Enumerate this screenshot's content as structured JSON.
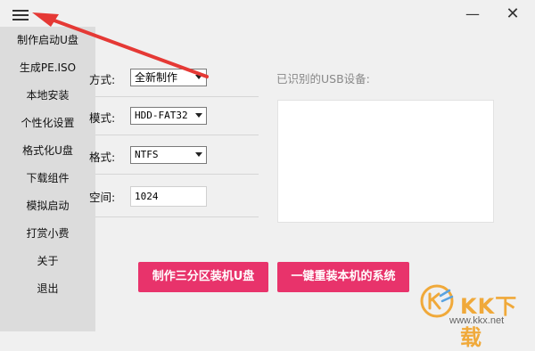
{
  "sidebar": {
    "items": [
      {
        "label": "制作启动U盘"
      },
      {
        "label": "生成PE.ISO"
      },
      {
        "label": "本地安装"
      },
      {
        "label": "个性化设置"
      },
      {
        "label": "格式化U盘"
      },
      {
        "label": "下载组件"
      },
      {
        "label": "模拟启动"
      },
      {
        "label": "打赏小费"
      },
      {
        "label": "关于"
      },
      {
        "label": "退出"
      }
    ]
  },
  "window_controls": {
    "minimize": "—",
    "close": "✕"
  },
  "form": {
    "method_label": "方式:",
    "method_value": "全新制作",
    "mode_label": "模式:",
    "mode_value": "HDD-FAT32",
    "format_label": "格式:",
    "format_value": "NTFS",
    "space_label": "空间:",
    "space_value": "1024"
  },
  "usb": {
    "label": "已识别的USB设备:"
  },
  "buttons": {
    "make_usb": "制作三分区装机U盘",
    "reinstall": "一键重装本机的系统"
  },
  "watermark": {
    "text": "KK下载",
    "url": "www.kkx.net"
  },
  "colors": {
    "accent": "#e8336b",
    "annotation_arrow": "#e53935",
    "watermark": "#f0a93a"
  },
  "icons": {
    "menu": "hamburger-menu-icon",
    "watermark_logo": "kk-logo-icon"
  }
}
